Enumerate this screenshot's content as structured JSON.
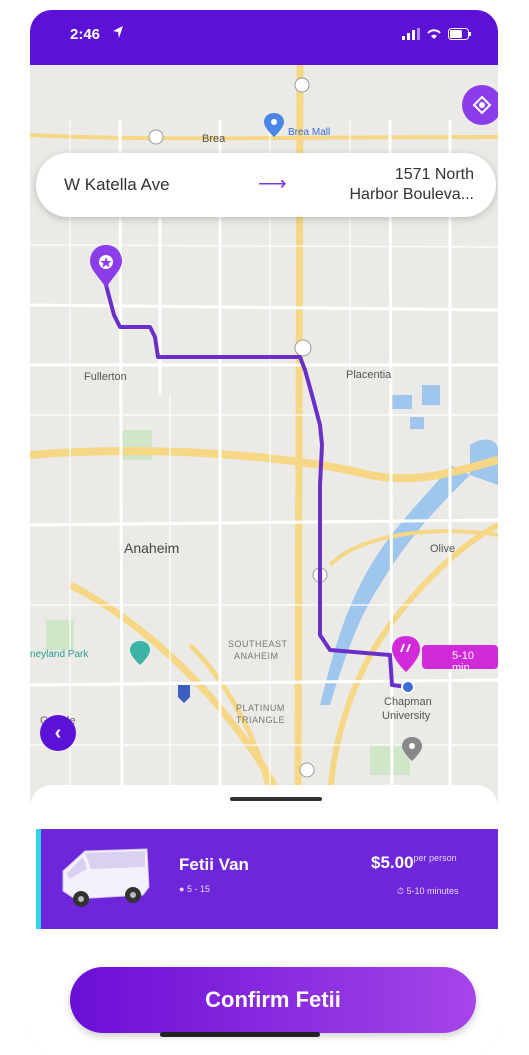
{
  "status_bar": {
    "time": "2:46"
  },
  "route": {
    "from": "W Katella Ave",
    "to_line1": "1571 North",
    "to_line2": "Harbor Bouleva...",
    "arrow": "⟶"
  },
  "map_labels": {
    "brea_mall": "Brea Mall",
    "brea": "Brea",
    "fullerton": "Fullerton",
    "placentia": "Placentia",
    "anaheim": "Anaheim",
    "olive": "Olive",
    "southeast": "SOUTHEAST",
    "anaheim_sm": "ANAHEIM",
    "disneyland": "neyland Park",
    "platinum": "PLATINUM",
    "triangle": "TRIANGLE",
    "chapman": "Chapman",
    "university": "University",
    "google": "Google"
  },
  "eta": {
    "label": "5-10 min"
  },
  "vehicle": {
    "name": "Fetii Van",
    "capacity": "5 - 15",
    "price": "$5.00",
    "price_unit": "per person",
    "time": "5-10 minutes"
  },
  "confirm": {
    "label": "Confirm Fetii"
  },
  "icons": {
    "back": "‹",
    "locate": "location-target-icon"
  },
  "colors": {
    "brand": "#5b12d6",
    "accent": "#8b3dea",
    "route": "#7c3aed",
    "eta": "#d12ad8",
    "card": "#6d26d9"
  }
}
